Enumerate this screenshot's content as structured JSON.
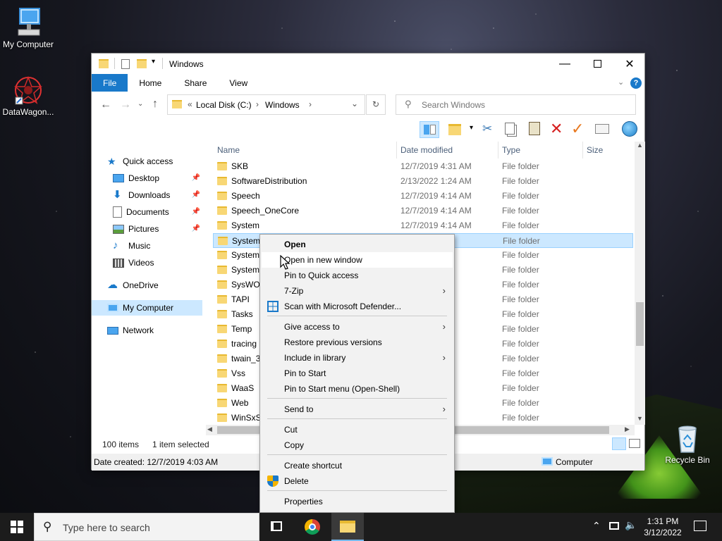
{
  "desktop": {
    "icons": [
      {
        "label": "My Computer"
      },
      {
        "label": "DataWagon..."
      },
      {
        "label": "Recycle Bin"
      }
    ]
  },
  "window": {
    "title": "Windows",
    "ribbon_tabs": [
      "File",
      "Home",
      "Share",
      "View"
    ],
    "address": {
      "crumbs": [
        "Local Disk (C:)",
        "Windows"
      ],
      "overflow": "«"
    },
    "search": {
      "placeholder": "Search Windows"
    },
    "nav": {
      "quick_access": "Quick access",
      "items": [
        {
          "label": "Desktop",
          "pinned": true
        },
        {
          "label": "Downloads",
          "pinned": true
        },
        {
          "label": "Documents",
          "pinned": true
        },
        {
          "label": "Pictures",
          "pinned": true
        },
        {
          "label": "Music",
          "pinned": false
        },
        {
          "label": "Videos",
          "pinned": false
        }
      ],
      "onedrive": "OneDrive",
      "my_computer": "My Computer",
      "network": "Network"
    },
    "columns": {
      "name": "Name",
      "date": "Date modified",
      "type": "Type",
      "size": "Size"
    },
    "rows": [
      {
        "name": "SKB",
        "date": "12/7/2019 4:31 AM",
        "type": "File folder"
      },
      {
        "name": "SoftwareDistribution",
        "date": "2/13/2022 1:24 AM",
        "type": "File folder"
      },
      {
        "name": "Speech",
        "date": "12/7/2019 4:14 AM",
        "type": "File folder"
      },
      {
        "name": "Speech_OneCore",
        "date": "12/7/2019 4:14 AM",
        "type": "File folder"
      },
      {
        "name": "System",
        "date": "12/7/2019 4:14 AM",
        "type": "File folder"
      },
      {
        "name": "System",
        "date": "PM",
        "type": "File folder"
      },
      {
        "name": "Systema",
        "date": "AM",
        "type": "File folder"
      },
      {
        "name": "System",
        "date": "AM",
        "type": "File folder"
      },
      {
        "name": "SysWOW",
        "date": "AM",
        "type": "File folder"
      },
      {
        "name": "TAPI",
        "date": "AM",
        "type": "File folder"
      },
      {
        "name": "Tasks",
        "date": "AM",
        "type": "File folder"
      },
      {
        "name": "Temp",
        "date": "PM",
        "type": "File folder"
      },
      {
        "name": "tracing",
        "date": "AM",
        "type": "File folder"
      },
      {
        "name": "twain_3",
        "date": "AM",
        "type": "File folder"
      },
      {
        "name": "Vss",
        "date": "AM",
        "type": "File folder"
      },
      {
        "name": "WaaS",
        "date": "AM",
        "type": "File folder"
      },
      {
        "name": "Web",
        "date": "AM",
        "type": "File folder"
      },
      {
        "name": "WinSxS",
        "date": "AM",
        "type": "File folder"
      }
    ],
    "status": {
      "count": "100 items",
      "selected": "1 item selected"
    },
    "details": {
      "created": "Date created: 12/7/2019 4:03 AM",
      "location": "Computer"
    }
  },
  "context_menu": {
    "items": [
      {
        "label": "Open",
        "bold": true
      },
      {
        "label": "Open in new window"
      },
      {
        "label": "Pin to Quick access"
      },
      {
        "label": "7-Zip",
        "submenu": true
      },
      {
        "label": "Scan with Microsoft Defender..."
      },
      {
        "label": "Give access to",
        "submenu": true
      },
      {
        "label": "Restore previous versions"
      },
      {
        "label": "Include in library",
        "submenu": true
      },
      {
        "label": "Pin to Start"
      },
      {
        "label": "Pin to Start menu (Open-Shell)"
      },
      {
        "label": "Send to",
        "submenu": true
      },
      {
        "label": "Cut"
      },
      {
        "label": "Copy"
      },
      {
        "label": "Create shortcut"
      },
      {
        "label": "Delete"
      },
      {
        "label": "Properties"
      }
    ]
  },
  "taskbar": {
    "search_placeholder": "Type here to search",
    "time": "1:31 PM",
    "date": "3/12/2022"
  },
  "colors": {
    "accent": "#1979ca",
    "selection": "#cce8ff",
    "folder": "#f8d775"
  }
}
